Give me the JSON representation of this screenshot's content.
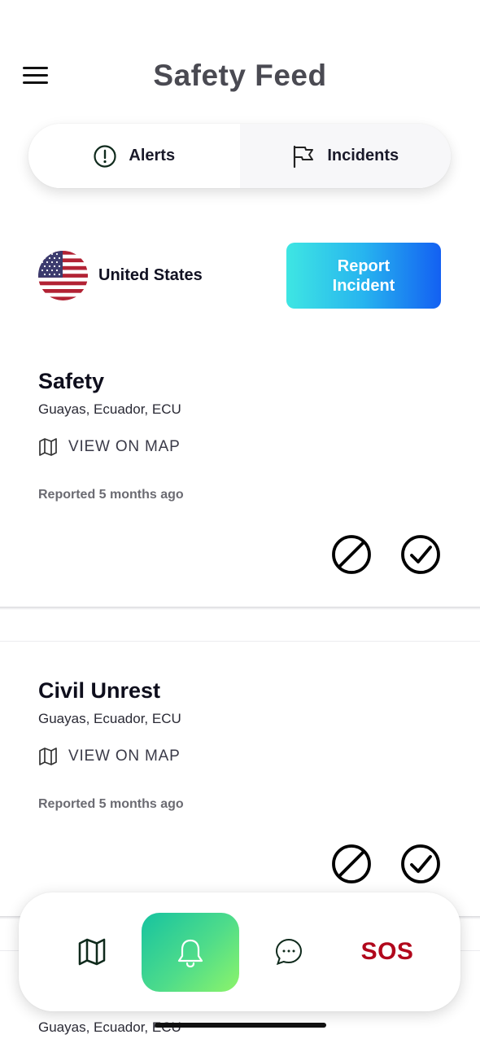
{
  "header": {
    "title": "Safety Feed"
  },
  "tabs": [
    {
      "label": "Alerts",
      "icon": "alert-circle-icon",
      "active": true
    },
    {
      "label": "Incidents",
      "icon": "flag-icon",
      "active": false
    }
  ],
  "country": {
    "name": "United States",
    "flag": "us-flag-icon"
  },
  "report_button": {
    "label": "Report\nIncident"
  },
  "incidents": [
    {
      "title": "Safety",
      "location": "Guayas, Ecuador, ECU",
      "map_link": "VIEW ON MAP",
      "reported": "Reported 5 months ago"
    },
    {
      "title": "Civil Unrest",
      "location": "Guayas, Ecuador, ECU",
      "map_link": "VIEW ON MAP",
      "reported": "Reported 5 months ago"
    }
  ],
  "peek": {
    "location": "Guayas, Ecuador, ECU"
  },
  "bottom_nav": {
    "items": [
      {
        "name": "map",
        "icon": "map-icon"
      },
      {
        "name": "alerts",
        "icon": "bell-icon",
        "active": true
      },
      {
        "name": "chat",
        "icon": "chat-bubble-icon"
      },
      {
        "name": "sos",
        "label": "SOS"
      }
    ]
  },
  "colors": {
    "sos": "#b1081c",
    "report_gradient_start": "#3ee6e3",
    "report_gradient_end": "#1360f2",
    "nav_active_start": "#16c3a0",
    "nav_active_end": "#8df46a"
  }
}
